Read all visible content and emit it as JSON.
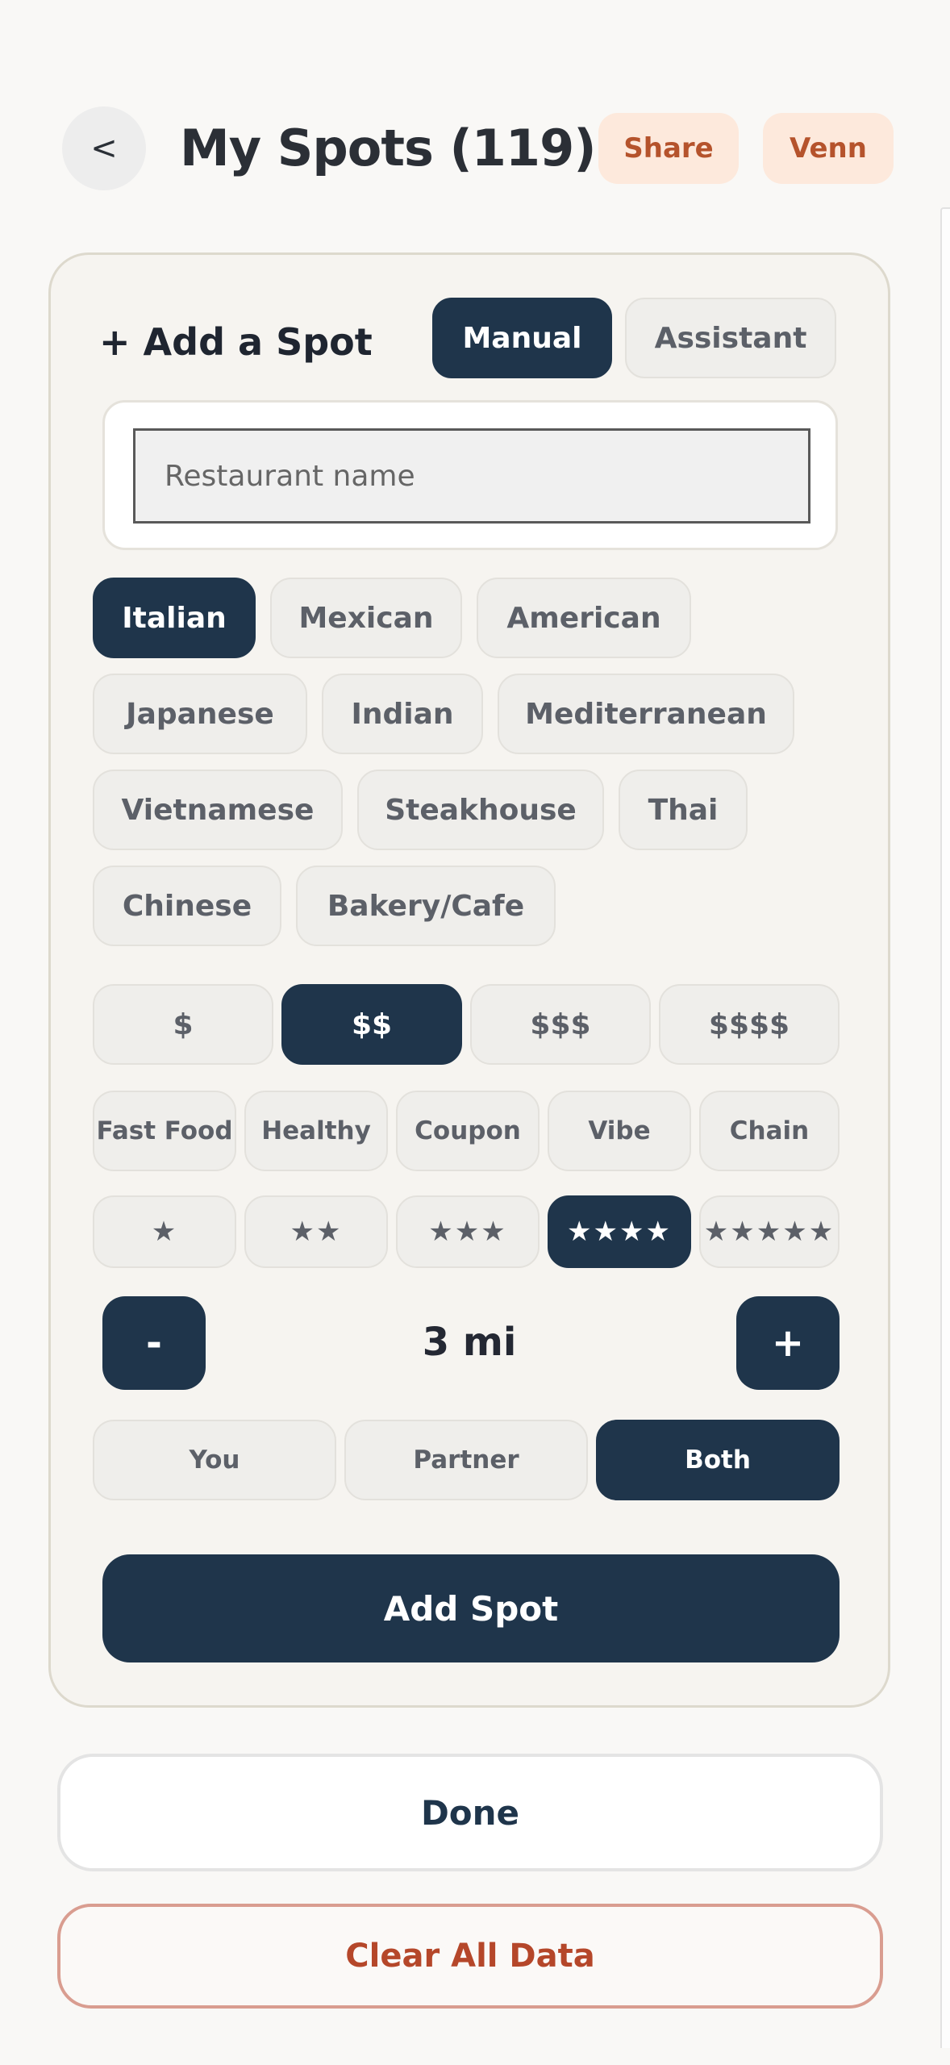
{
  "header": {
    "back_label": "<",
    "title": "My Spots (119)",
    "share_label": "Share",
    "venn_label": "Venn"
  },
  "add_spot": {
    "title": "+ Add a Spot",
    "modes": [
      {
        "label": "Manual",
        "selected": true
      },
      {
        "label": "Assistant",
        "selected": false
      }
    ],
    "name_placeholder": "Restaurant name",
    "name_value": "",
    "cuisines": [
      {
        "label": "Italian",
        "selected": true
      },
      {
        "label": "Mexican",
        "selected": false
      },
      {
        "label": "American",
        "selected": false
      },
      {
        "label": "Japanese",
        "selected": false
      },
      {
        "label": "Indian",
        "selected": false
      },
      {
        "label": "Mediterranean",
        "selected": false
      },
      {
        "label": "Vietnamese",
        "selected": false
      },
      {
        "label": "Steakhouse",
        "selected": false
      },
      {
        "label": "Thai",
        "selected": false
      },
      {
        "label": "Chinese",
        "selected": false
      },
      {
        "label": "Bakery/Cafe",
        "selected": false
      }
    ],
    "prices": [
      {
        "label": "$",
        "selected": false
      },
      {
        "label": "$$",
        "selected": true
      },
      {
        "label": "$$$",
        "selected": false
      },
      {
        "label": "$$$$",
        "selected": false
      }
    ],
    "tags": [
      {
        "label": "Fast Food",
        "selected": false
      },
      {
        "label": "Healthy",
        "selected": false
      },
      {
        "label": "Coupon",
        "selected": false
      },
      {
        "label": "Vibe",
        "selected": false
      },
      {
        "label": "Chain",
        "selected": false
      }
    ],
    "ratings": [
      {
        "label": "★",
        "selected": false
      },
      {
        "label": "★★",
        "selected": false
      },
      {
        "label": "★★★",
        "selected": false
      },
      {
        "label": "★★★★",
        "selected": true
      },
      {
        "label": "★★★★★",
        "selected": false
      }
    ],
    "distance": {
      "decrement_label": "-",
      "value": "3 mi",
      "increment_label": "+"
    },
    "who": [
      {
        "label": "You",
        "selected": false
      },
      {
        "label": "Partner",
        "selected": false
      },
      {
        "label": "Both",
        "selected": true
      }
    ],
    "submit_label": "Add Spot"
  },
  "footer": {
    "done_label": "Done",
    "clear_label": "Clear All Data"
  },
  "colors": {
    "accent": "#1f354b",
    "chip_bg": "#efeeeb",
    "pill_bg": "#fde9dc",
    "danger": "#b5472a",
    "background": "#f9f8f6"
  }
}
